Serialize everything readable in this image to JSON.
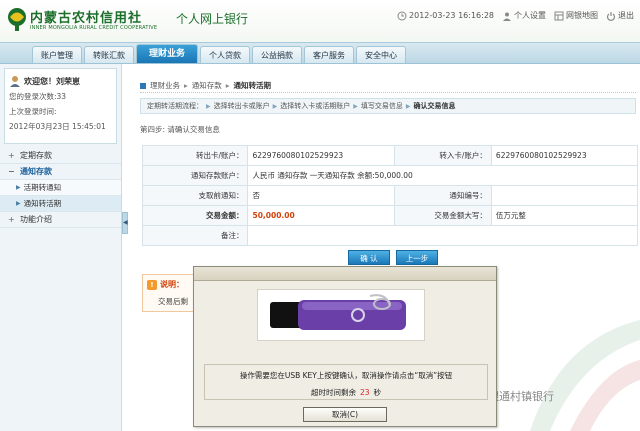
{
  "header": {
    "bank_name": "内蒙古农村信用社",
    "bank_name_en": "INNER MONGOLIA RURAL CREDIT COOPERATIVE",
    "app_title": "个人网上银行",
    "datetime": "2012-03-23 16:16:28",
    "settings_label": "个人设置",
    "sitemap_label": "网银地图",
    "exit_label": "退出",
    "brand_color": "#1c6e2b"
  },
  "nav": {
    "tabs": [
      {
        "label": "账户管理"
      },
      {
        "label": "转账汇款"
      },
      {
        "label": "理财业务"
      },
      {
        "label": "个人贷款"
      },
      {
        "label": "公益捐款"
      },
      {
        "label": "客户服务"
      },
      {
        "label": "安全中心"
      }
    ],
    "active_index": 2
  },
  "sidebar": {
    "welcome": "欢迎您！刘荣崽",
    "login_count": "您的登录次数:33",
    "last_login_label": "上次登录时间:",
    "last_login_time": "2012年03月23日 15:45:01",
    "menu": [
      {
        "label": "定期存款",
        "toggle": "+"
      },
      {
        "label": "通知存款",
        "toggle": "−"
      },
      {
        "label": "活期转通知"
      },
      {
        "label": "通知转活期"
      },
      {
        "label": "功能介绍",
        "toggle": "+"
      }
    ]
  },
  "main": {
    "breadcrumb": [
      "理财业务",
      "通知存款",
      "通知转活期"
    ],
    "steps_label": "定期转活期流程：",
    "steps": [
      "选择转出卡或账户",
      "选择转入卡或活期账户",
      "填写交易信息",
      "确认交易信息"
    ],
    "step_title": "第四步: 请确认交易信息",
    "rows": {
      "from_label": "转出卡/账户：",
      "from_value": "6229760080102529923",
      "to_label": "转入卡/账户：",
      "to_value": "6229760080102529923",
      "deposit_label": "通知存款账户：",
      "deposit_value": "人民币  通知存款  一天通知存款  余额:50,000.00",
      "advance_label": "支取前通知：",
      "advance_value": "否",
      "notice_label": "通知编号：",
      "notice_value": "",
      "amount_label": "交易金额：",
      "amount_value": "50,000.00",
      "amount_cn_label": "交易金额大写：",
      "amount_cn_value": "伍万元整",
      "remark_label": "备注："
    },
    "confirm_label": "确  认",
    "back_label": "上一步",
    "note_title": "说明：",
    "note_text": "交易后剩"
  },
  "dialog": {
    "message": "操作需要您在USB KEY上按键确认，取消操作请点击“取消”按钮",
    "timeout_prefix": "超时时间剩余",
    "timeout_value": "23",
    "timeout_suffix": "秒",
    "cancel_label": "取消(C)"
  },
  "watermark": {
    "text": "银通村镇银行"
  }
}
